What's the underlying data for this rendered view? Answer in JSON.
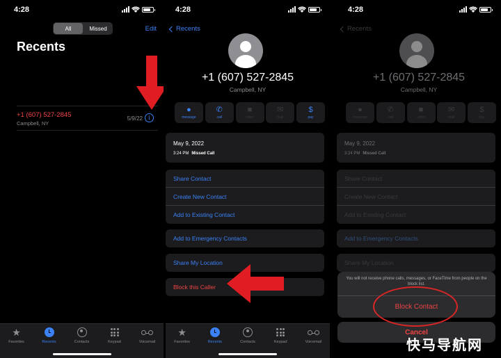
{
  "status": {
    "time": "4:28"
  },
  "recents": {
    "segments": [
      "All",
      "Missed"
    ],
    "edit_label": "Edit",
    "title": "Recents",
    "entry": {
      "number": "+1 (607) 527-2845",
      "location": "Campbell, NY",
      "date": "5/9/22",
      "info_glyph": "i"
    }
  },
  "tabs": [
    {
      "label": "Favorites",
      "icon": "star-icon"
    },
    {
      "label": "Recents",
      "icon": "clock-icon"
    },
    {
      "label": "Contacts",
      "icon": "person-icon"
    },
    {
      "label": "Keypad",
      "icon": "keypad-icon"
    },
    {
      "label": "Voicemail",
      "icon": "voicemail-icon"
    }
  ],
  "detail": {
    "back_label": "Recents",
    "number": "+1 (607) 527-2845",
    "location": "Campbell, NY",
    "actions": [
      {
        "label": "message",
        "icon": "message-icon",
        "glyph": "💬"
      },
      {
        "label": "call",
        "icon": "phone-icon",
        "glyph": "📞"
      },
      {
        "label": "video",
        "icon": "video-icon",
        "glyph": "■"
      },
      {
        "label": "mail",
        "icon": "mail-icon",
        "glyph": "✉"
      },
      {
        "label": "pay",
        "icon": "dollar-icon",
        "glyph": "$"
      }
    ],
    "call": {
      "date": "May 9, 2022",
      "time": "3:24 PM",
      "type": "Missed Call"
    },
    "menu_group1": [
      "Share Contact",
      "Create New Contact",
      "Add to Existing Contact"
    ],
    "emergency": "Add to Emergency Contacts",
    "share_location": "Share My Location",
    "block": "Block this Caller"
  },
  "sheet": {
    "message": "You will not receive phone calls, messages, or FaceTime from people on the block list.",
    "confirm": "Block Contact",
    "cancel": "Cancel"
  },
  "watermark": "快马导航网",
  "colors": {
    "accent": "#3b82f6",
    "destructive": "#ef4444",
    "arrow": "#e11d24"
  }
}
